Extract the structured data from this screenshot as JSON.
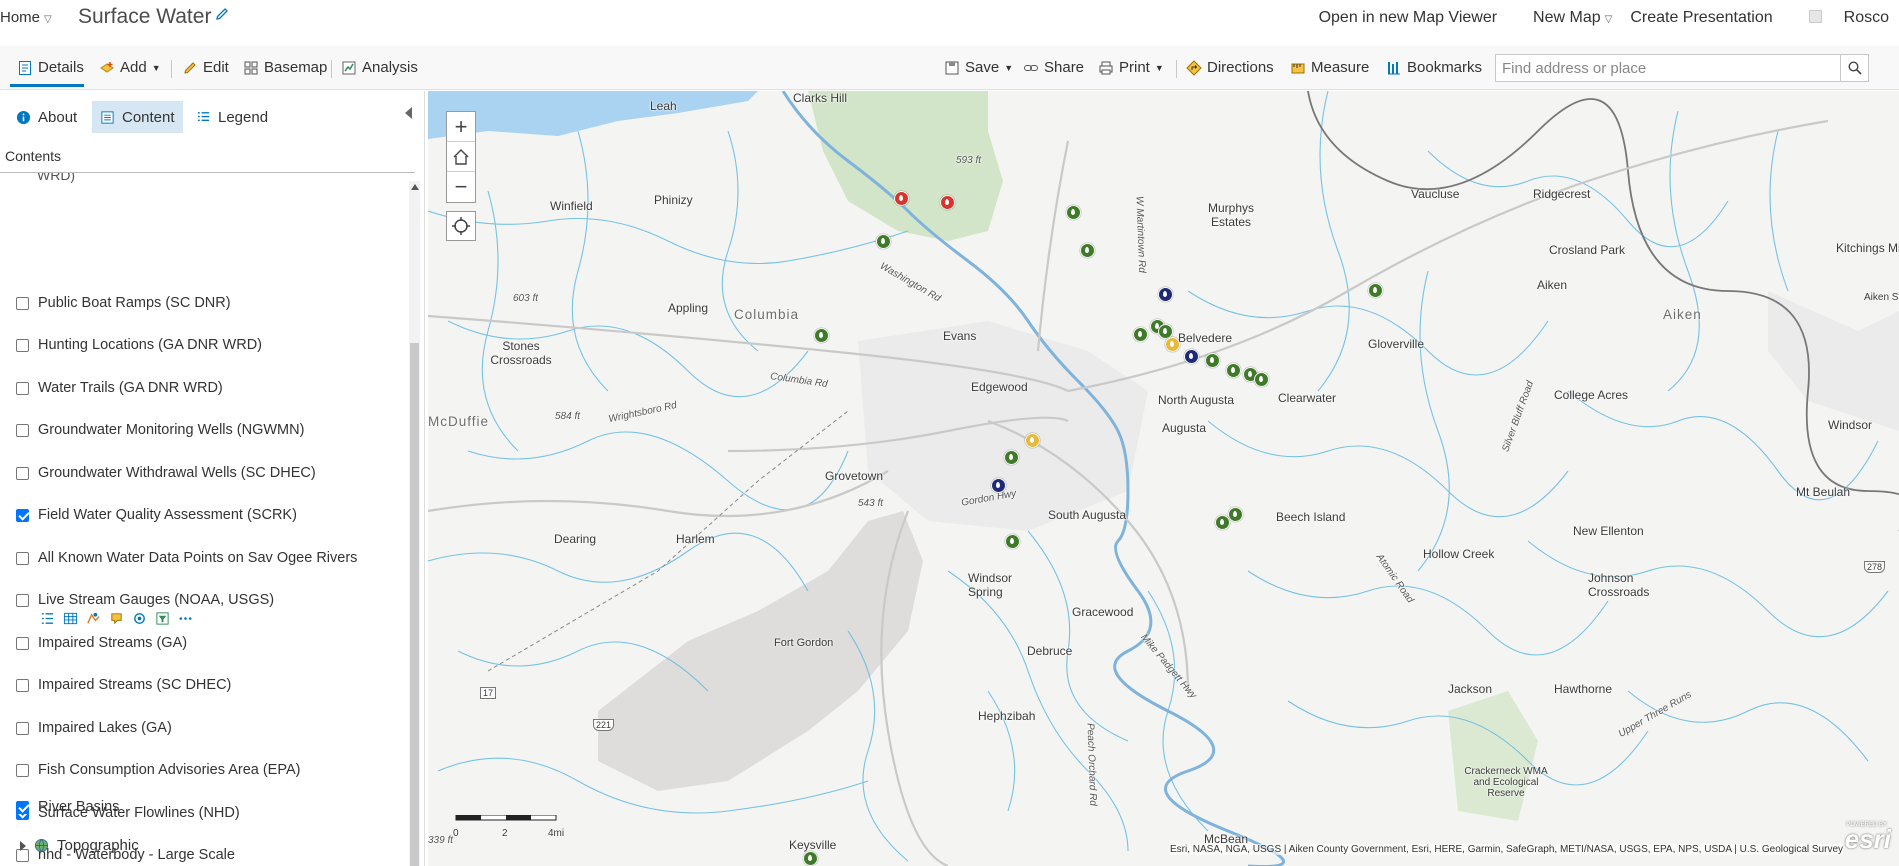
{
  "header": {
    "home_label": "Home",
    "map_title": "Surface Water",
    "open_map_viewer": "Open in new Map Viewer",
    "new_map": "New Map",
    "create_presentation": "Create Presentation",
    "user_name": "Rosco"
  },
  "toolbar": {
    "details": "Details",
    "add": "Add",
    "edit": "Edit",
    "basemap": "Basemap",
    "analysis": "Analysis",
    "save": "Save",
    "share": "Share",
    "print": "Print",
    "directions": "Directions",
    "measure": "Measure",
    "bookmarks": "Bookmarks",
    "search_placeholder": "Find address or place"
  },
  "panel": {
    "tabs": [
      "About",
      "Content",
      "Legend"
    ],
    "active_tab": "Content",
    "contents_label": "Contents",
    "cut_text": "WRD)",
    "layers": [
      {
        "label": "Public Boat Ramps (SC DNR)",
        "checked": false
      },
      {
        "label": "Hunting Locations (GA DNR WRD)",
        "checked": false
      },
      {
        "label": "Water Trails (GA DNR WRD)",
        "checked": false
      },
      {
        "label": "Groundwater Monitoring Wells (NGWMN)",
        "checked": false
      },
      {
        "label": "Groundwater Withdrawal Wells (SC DHEC)",
        "checked": false
      },
      {
        "label": "Field Water Quality Assessment (SCRK)",
        "checked": true
      },
      {
        "label": "All Known Water Data Points on Sav Ogee Rivers",
        "checked": false
      },
      {
        "label": "Live Stream Gauges (NOAA, USGS)",
        "checked": false
      },
      {
        "label": "Impaired Streams (GA)",
        "checked": false
      },
      {
        "label": "Impaired Streams (SC DHEC)",
        "checked": false
      },
      {
        "label": "Impaired Lakes (GA)",
        "checked": false
      },
      {
        "label": "Fish Consumption Advisories Area (EPA)",
        "checked": false
      },
      {
        "label": "Surface Water Flowlines (NHD)",
        "checked": true
      },
      {
        "label": "nhd - Waterbody - Large Scale",
        "checked": false
      },
      {
        "label": "River Basins",
        "checked": true
      }
    ],
    "basemap_layer": "Topographic"
  },
  "map": {
    "places": [
      {
        "name": "Clarks Hill",
        "cls": ""
      },
      {
        "name": "Leah",
        "cls": ""
      },
      {
        "name": "Phinizy",
        "cls": ""
      },
      {
        "name": "Winfield",
        "cls": ""
      },
      {
        "name": "Appling",
        "cls": ""
      },
      {
        "name": "Columbia",
        "cls": "big"
      },
      {
        "name": "Evans",
        "cls": ""
      },
      {
        "name": "Stones Crossroads",
        "cls": ""
      },
      {
        "name": "Edgewood",
        "cls": ""
      },
      {
        "name": "Murphys Estates",
        "cls": ""
      },
      {
        "name": "Belvedere",
        "cls": ""
      },
      {
        "name": "North Augusta",
        "cls": ""
      },
      {
        "name": "Clearwater",
        "cls": ""
      },
      {
        "name": "Augusta",
        "cls": ""
      },
      {
        "name": "Grovetown",
        "cls": ""
      },
      {
        "name": "South Augusta",
        "cls": ""
      },
      {
        "name": "Beech Island",
        "cls": ""
      },
      {
        "name": "Dearing",
        "cls": ""
      },
      {
        "name": "Harlem",
        "cls": ""
      },
      {
        "name": "Windsor Spring",
        "cls": ""
      },
      {
        "name": "Fort Gordon",
        "cls": ""
      },
      {
        "name": "Gracewood",
        "cls": ""
      },
      {
        "name": "Debruce",
        "cls": ""
      },
      {
        "name": "Hephzibah",
        "cls": ""
      },
      {
        "name": "Keysville",
        "cls": ""
      },
      {
        "name": "McBean",
        "cls": ""
      },
      {
        "name": "Vaucluse",
        "cls": ""
      },
      {
        "name": "Ridgecrest",
        "cls": ""
      },
      {
        "name": "Crosland Park",
        "cls": ""
      },
      {
        "name": "Aiken",
        "cls": ""
      },
      {
        "name": "Aiken",
        "cls": "big"
      },
      {
        "name": "Kitchings Mill",
        "cls": ""
      },
      {
        "name": "Gloverville",
        "cls": ""
      },
      {
        "name": "College Acres",
        "cls": ""
      },
      {
        "name": "Windsor",
        "cls": ""
      },
      {
        "name": "Mt Beulah",
        "cls": ""
      },
      {
        "name": "New Ellenton",
        "cls": ""
      },
      {
        "name": "Hollow Creek",
        "cls": ""
      },
      {
        "name": "Johnson Crossroads",
        "cls": ""
      },
      {
        "name": "Jackson",
        "cls": ""
      },
      {
        "name": "Hawthorne",
        "cls": ""
      },
      {
        "name": "Crackerneck WMA and Ecological Reserve",
        "cls": ""
      },
      {
        "name": "McDuffie",
        "cls": "big"
      },
      {
        "name": "Aiken St",
        "cls": ""
      },
      {
        "name": "593 ft",
        "cls": "small"
      },
      {
        "name": "603 ft",
        "cls": "small"
      },
      {
        "name": "584 ft",
        "cls": "small"
      },
      {
        "name": "543 ft",
        "cls": "small"
      },
      {
        "name": "339 ft",
        "cls": "small"
      },
      {
        "name": "Columbia Rd",
        "cls": "small"
      },
      {
        "name": "Washington Rd",
        "cls": "small"
      },
      {
        "name": "Wrightsboro Rd",
        "cls": "small"
      },
      {
        "name": "Gordon Hwy",
        "cls": "small"
      },
      {
        "name": "Peach Orchard Rd",
        "cls": "small"
      },
      {
        "name": "Mike Padgett Hwy",
        "cls": "small"
      },
      {
        "name": "W Martintown Rd",
        "cls": "small"
      },
      {
        "name": "Atomic Road",
        "cls": "small"
      },
      {
        "name": "Silver Bluff Road",
        "cls": "small"
      },
      {
        "name": "Upper Three Runs",
        "cls": "small"
      }
    ],
    "scale_labels": [
      "0",
      "2",
      "4mi"
    ],
    "route_shields": [
      "17",
      "221",
      "278"
    ],
    "attribution": "Esri, NASA, NGA, USGS | Aiken County Government, Esri, HERE, Garmin, SafeGraph, METI/NASA, USGS, EPA, NPS, USDA | U.S. Geological Survey",
    "esri_logo": "esri",
    "powered_by": "POWERED BY",
    "marker_colors": {
      "green": "#3f7a28",
      "red": "#d9342b",
      "navy": "#1e2a78",
      "yellow": "#e8b93a"
    }
  }
}
